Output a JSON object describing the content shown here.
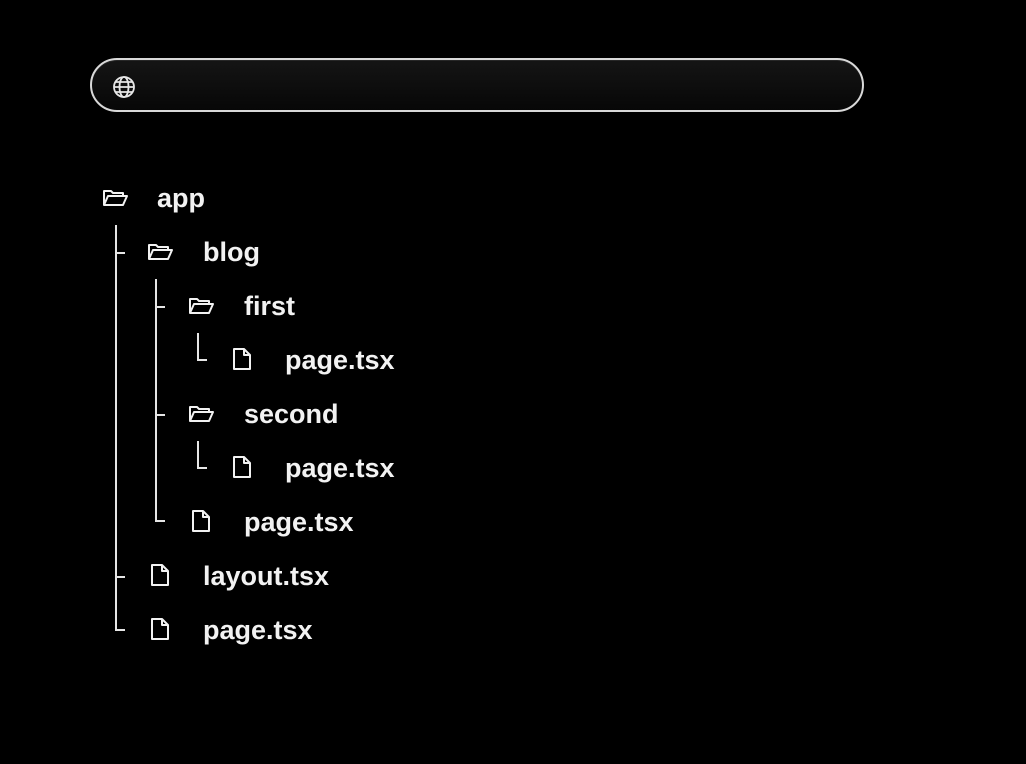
{
  "address_bar": {
    "icon": "globe-icon",
    "url": ""
  },
  "tree": {
    "root": {
      "name": "app",
      "icon": "folder-open-icon"
    },
    "blog": {
      "name": "blog",
      "icon": "folder-open-icon"
    },
    "first": {
      "name": "first",
      "icon": "folder-open-icon"
    },
    "first_page": {
      "name": "page.tsx",
      "icon": "file-icon"
    },
    "second": {
      "name": "second",
      "icon": "folder-open-icon"
    },
    "second_page": {
      "name": "page.tsx",
      "icon": "file-icon"
    },
    "blog_page": {
      "name": "page.tsx",
      "icon": "file-icon"
    },
    "layout": {
      "name": "layout.tsx",
      "icon": "file-icon"
    },
    "root_page": {
      "name": "page.tsx",
      "icon": "file-icon"
    }
  },
  "colors": {
    "background": "#000000",
    "text": "#f2f2f2",
    "lines": "#e6e6e6",
    "bar_border": "#d9d9d9"
  }
}
